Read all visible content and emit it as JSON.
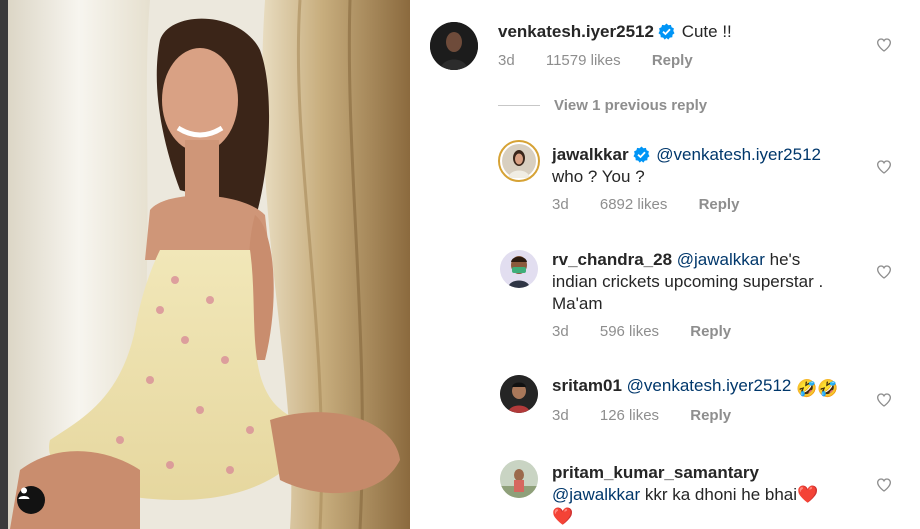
{
  "comments": [
    {
      "username": "venkatesh.iyer2512",
      "verified": true,
      "text": "Cute !!",
      "time": "3d",
      "likes": "11579 likes",
      "reply": "Reply"
    },
    {
      "username": "jawalkkar",
      "verified": true,
      "mention": "@venkatesh.iyer2512",
      "text": "who ? You ?",
      "time": "3d",
      "likes": "6892 likes",
      "reply": "Reply"
    },
    {
      "username": "rv_chandra_28",
      "mention": "@jawalkkar",
      "text_line1": "he's",
      "text_line2": "indian crickets upcoming superstar .",
      "text_line3": "Ma'am",
      "time": "3d",
      "likes": "596 likes",
      "reply": "Reply"
    },
    {
      "username": "sritam01",
      "mention": "@venkatesh.iyer2512",
      "text": "🤣🤣",
      "time": "3d",
      "likes": "126 likes",
      "reply": "Reply"
    },
    {
      "username": "pritam_kumar_samantary",
      "mention": "@jawalkkar",
      "text": "kkr ka dhoni he bhai❤️",
      "text_line2": "❤️"
    }
  ],
  "view_replies_label": "View 1 previous reply",
  "icons": {
    "like": "heart-outline-icon",
    "verified": "verified-badge-icon",
    "tagged_user": "user-tag-icon"
  },
  "colors": {
    "text": "#262626",
    "secondary": "#8e8e8e",
    "mention": "#00376b",
    "verified": "#0095f6"
  }
}
